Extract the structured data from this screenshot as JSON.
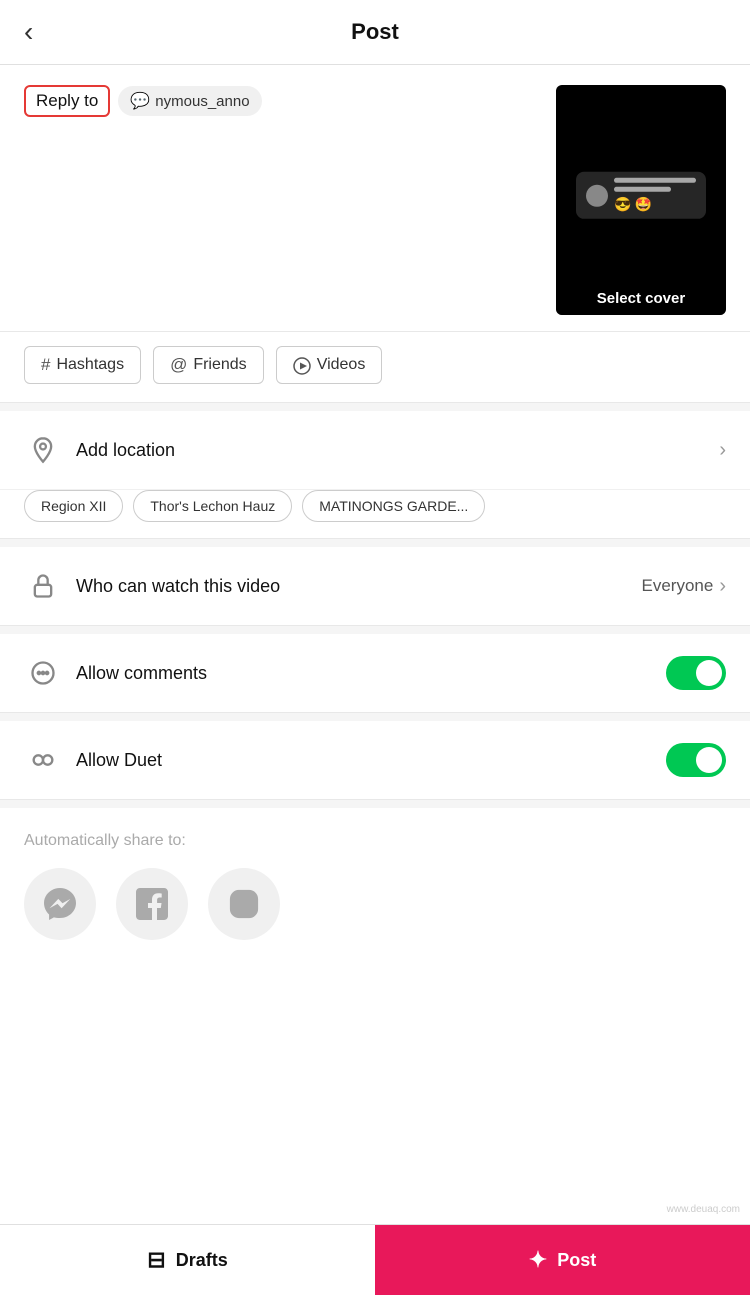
{
  "header": {
    "title": "Post",
    "back_icon": "‹"
  },
  "reply": {
    "label": "Reply to",
    "username_icon": "💬",
    "username": "nymous_anno"
  },
  "video": {
    "select_cover_label": "Select cover"
  },
  "tags": [
    {
      "icon": "#",
      "label": "Hashtags"
    },
    {
      "icon": "@",
      "label": "Friends"
    },
    {
      "icon": "▶",
      "label": "Videos"
    }
  ],
  "location": {
    "label": "Add location",
    "chips": [
      "Region XII",
      "Thor's Lechon Hauz",
      "MATINONGS GARDE..."
    ]
  },
  "who_can_watch": {
    "label": "Who can watch this video",
    "value": "Everyone"
  },
  "allow_comments": {
    "label": "Allow comments",
    "enabled": true
  },
  "allow_duet": {
    "label": "Allow Duet",
    "enabled": true
  },
  "share": {
    "label": "Automatically share to:"
  },
  "bottom": {
    "drafts_icon": "⊟",
    "drafts_label": "Drafts",
    "post_icon": "✦",
    "post_label": "Post"
  },
  "watermark": "www.deuaq.com"
}
